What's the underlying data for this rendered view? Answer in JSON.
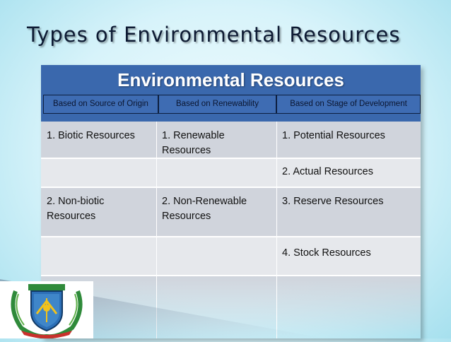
{
  "slide": {
    "title": "Types of Environmental Resources"
  },
  "table": {
    "heading": "Environmental Resources",
    "subheaders": [
      "Based on Source of Origin",
      "Based on Renewability",
      "Based on Stage of Development"
    ],
    "rows": [
      [
        "1. Biotic Resources",
        "1. Renewable Resources",
        "1. Potential Resources"
      ],
      [
        "",
        "",
        "2. Actual Resources"
      ],
      [
        "2. Non-biotic Resources",
        "2. Non-Renewable Resources",
        "3. Reserve Resources"
      ],
      [
        "",
        "",
        "4. Stock Resources"
      ],
      [
        "",
        "",
        ""
      ]
    ]
  },
  "colors": {
    "header_blue": "#3a68ad",
    "row_dark": "#d0d4dc",
    "row_light": "#e6e8ec",
    "title_text": "#0d1a33"
  },
  "logo": {
    "icon": "university-crest-icon"
  }
}
